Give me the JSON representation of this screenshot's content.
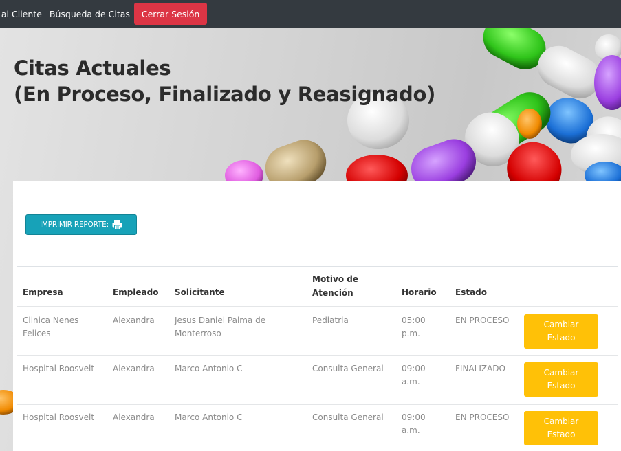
{
  "nav": {
    "links": [
      "n al Cliente",
      "Búsqueda de Citas"
    ],
    "logout_label": "Cerrar Sesión"
  },
  "hero": {
    "title_line1": "Citas Actuales",
    "title_line2": "(En Proceso, Finalizado y Reasignado)"
  },
  "report": {
    "print_label": "IMPRIMIR REPORTE:",
    "print_icon": "printer-icon"
  },
  "table": {
    "headers": {
      "empresa": "Empresa",
      "empleado": "Empleado",
      "solicitante": "Solicitante",
      "motivo": "Motivo de Atención",
      "horario": "Horario",
      "estado": "Estado"
    },
    "rows": [
      {
        "empresa": "Clinica Nenes Felices",
        "empleado": "Alexandra",
        "solicitante": "Jesus Daniel Palma de Monterroso",
        "motivo": "Pediatria",
        "horario": "05:00 p.m.",
        "estado": "EN PROCESO",
        "action": "Cambiar Estado"
      },
      {
        "empresa": "Hospital Roosvelt",
        "empleado": "Alexandra",
        "solicitante": "Marco Antonio C",
        "motivo": "Consulta General",
        "horario": "09:00 a.m.",
        "estado": "FINALIZADO",
        "action": "Cambiar Estado"
      },
      {
        "empresa": "Hospital Roosvelt",
        "empleado": "Alexandra",
        "solicitante": "Marco Antonio C",
        "motivo": "Consulta General",
        "horario": "09:00 a.m.",
        "estado": "EN PROCESO",
        "action": "Cambiar Estado"
      }
    ]
  },
  "colors": {
    "navbar": "#343a40",
    "danger": "#dc3545",
    "info": "#17a2b8",
    "warning": "#ffc107"
  }
}
